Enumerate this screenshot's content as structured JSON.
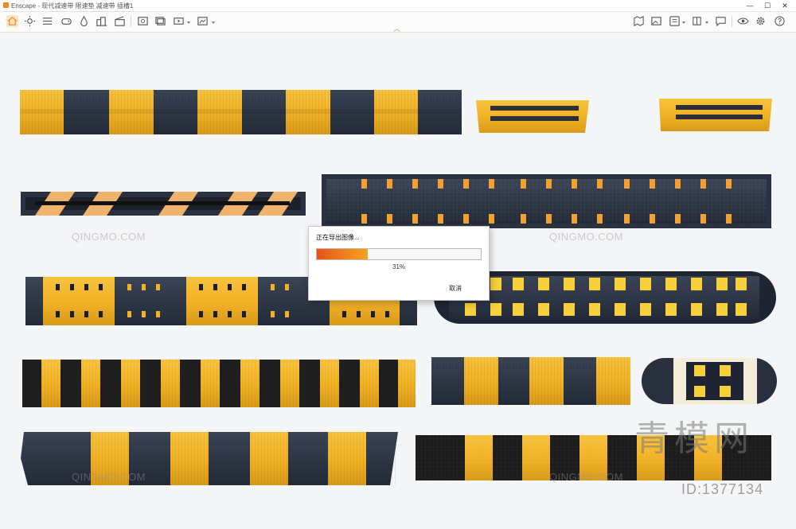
{
  "app": {
    "title": "Enscape - 现代减速带 限速垫 减速带 插槽1",
    "window_controls": {
      "minimize": "—",
      "maximize": "☐",
      "close": "✕"
    }
  },
  "toolbar": {
    "left_icons": [
      "home-icon",
      "sun-icon",
      "list-icon",
      "controller-icon",
      "drop-icon",
      "buildings-icon",
      "clapper-icon",
      "screenshot-icon",
      "batch-render-icon",
      "video-export-icon",
      "panorama-export-icon"
    ],
    "right_icons": [
      "map-icon",
      "image-icon",
      "asset-library-icon",
      "book-icon",
      "settings-sliders-icon",
      "chat-icon",
      "eye-icon",
      "gear-icon",
      "help-icon"
    ]
  },
  "dialog": {
    "title": "正在导出图像...",
    "progress_percent": 31,
    "progress_label": "31%",
    "cancel_label": "取消"
  },
  "colors": {
    "yellow": "#f2b226",
    "dark": "#2f3747",
    "black": "#1c1c1c",
    "accent": "#f08a24"
  },
  "watermark": {
    "text": "QINGMO.COM",
    "big_text": "青模网",
    "id_text": "ID:1377134"
  }
}
